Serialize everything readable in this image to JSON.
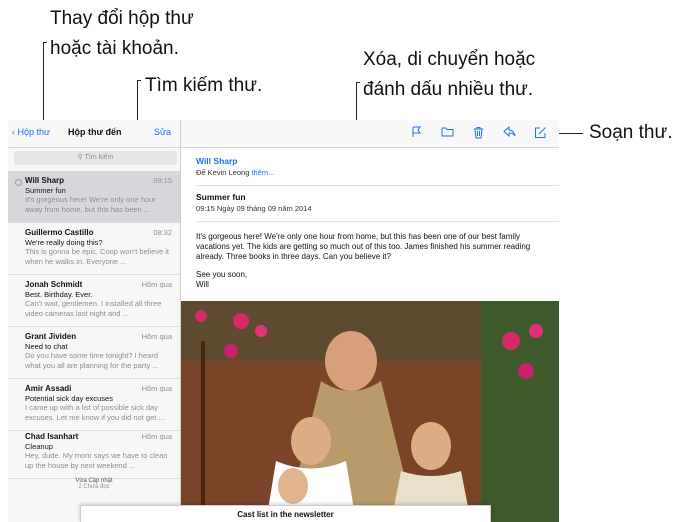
{
  "callouts": {
    "switch": "Thay đổi hộp thư\nhoặc tài khoản.",
    "switch_l1": "Thay đổi hộp thư",
    "switch_l2": "hoặc tài khoản.",
    "search": "Tìm kiếm thư.",
    "edit_l1": "Xóa, di chuyển hoặc",
    "edit_l2": "đánh dấu nhiều thư.",
    "compose": "Soạn thư."
  },
  "nav": {
    "back": "Hộp thư",
    "title": "Hộp thư đến",
    "edit": "Sửa"
  },
  "search": {
    "placeholder": "Tìm kiếm"
  },
  "messages": [
    {
      "from": "Will Sharp",
      "time": "09:15",
      "subject": "Summer fun",
      "preview": "It's gorgeous here! We're only one hour away from home, but this has been ..."
    },
    {
      "from": "Guillermo Castillo",
      "time": "08:32",
      "subject": "We're really doing this?",
      "preview": "This is gonna be epic. Coop won't believe it when he walks in. Everyone ..."
    },
    {
      "from": "Jonah Schmidt",
      "time": "Hôm qua",
      "subject": "Best. Birthday. Ever.",
      "preview": "Can't wait, gentlemen. I installed all three video cameras last night and ..."
    },
    {
      "from": "Grant Jividen",
      "time": "Hôm qua",
      "subject": "Need to chat",
      "preview": "Do you have some time tonight? I heard what you all are planning for the party ..."
    },
    {
      "from": "Amir Assadi",
      "time": "Hôm qua",
      "subject": "Potential sick day excuses",
      "preview": "I came up with a list of possible sick day excuses. Let me know if you did not get ..."
    },
    {
      "from": "Chad Isanhart",
      "time": "Hôm qua",
      "subject": "Cleanup",
      "preview": "Hey, dude. My mom says we have to clean up the house by next weekend ..."
    }
  ],
  "list_footer": {
    "updated": "Vừa Cập nhật",
    "unread": "2 Chưa đọc"
  },
  "message": {
    "from": "Will Sharp",
    "to": "Đế Kevin Leong",
    "more": "thêm...",
    "subject": "Summer fun",
    "date": "09:15 Ngày 09 tháng 09 năm 2014",
    "body1": "It's gorgeous here! We're only one hour from home, but this has been one of our best family vacations yet. The kids are getting so much out of this too. James finished his summer reading already. Three books in three days. Can you believe it?",
    "body2": "See you soon,",
    "body3": "Will"
  },
  "sheet": {
    "title": "Cast list in the newsletter"
  },
  "colors": {
    "accent": "#1a73e8"
  },
  "icons": [
    "flag-icon",
    "folder-icon",
    "trash-icon",
    "reply-icon",
    "compose-icon"
  ]
}
